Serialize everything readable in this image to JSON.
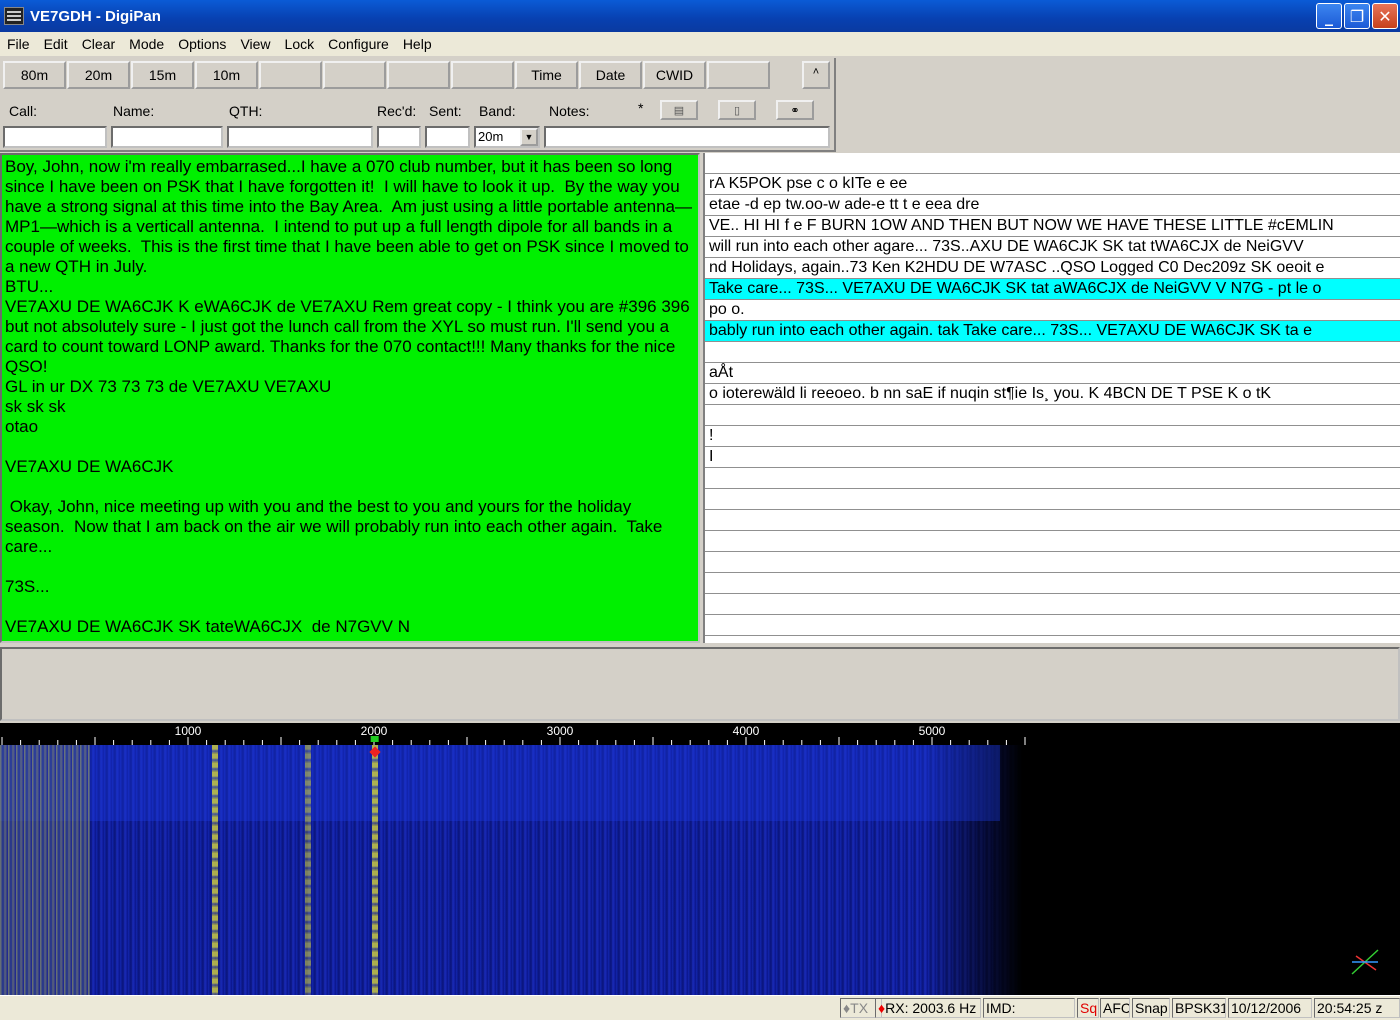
{
  "window": {
    "title": "VE7GDH - DigiPan"
  },
  "menu": [
    "File",
    "Edit",
    "Clear",
    "Mode",
    "Options",
    "View",
    "Lock",
    "Configure",
    "Help"
  ],
  "toolbar": {
    "buttons": [
      "80m",
      "20m",
      "15m",
      "10m",
      "",
      "",
      "",
      "",
      "Time",
      "Date",
      "CWID",
      ""
    ],
    "scroll_up": "˄"
  },
  "log": {
    "call_label": "Call:",
    "name_label": "Name:",
    "qth_label": "QTH:",
    "recd_label": "Rec'd:",
    "sent_label": "Sent:",
    "band_label": "Band:",
    "notes_label": "Notes:",
    "star": "*",
    "call_value": "",
    "name_value": "",
    "qth_value": "",
    "recd_value": "",
    "sent_value": "",
    "band_value": "20m",
    "notes_value": ""
  },
  "rx_text": "Boy, John, now i'm really embarrased...I have a 070 club number, but it has been so long since I have been on PSK that I have forgotten it!  I will have to look it up.  By the way you have a strong signal at this time into the Bay Area.  Am just using a little portable antenna—MP1—which is a verticall antenna.  I intend to put up a full length dipole for all bands in a couple of weeks.  This is the first time that I have been able to get on PSK since I moved to a new QTH in July.\nBTU...\nVE7AXU DE WA6CJK K eWA6CJK de VE7AXU Rem great copy - I think you are #396 396 but not absolutely sure - I just got the lunch call from the XYL so must run. I'll send you a card to count toward LONP award. Thanks for the 070 contact!!! Many thanks for the nice QSO!\nGL in ur DX 73 73 73 de VE7AXU VE7AXU\nsk sk sk\notao\n\nVE7AXU DE WA6CJK\n\n Okay, John, nice meeting up with you and the best to you and yours for the holiday season.  Now that I am back on the air we will probably run into each other again.  Take care...\n\n73S...\n\nVE7AXU DE WA6CJK SK tateWA6CJX  de N7GVV N",
  "channels": [
    {
      "text": "",
      "highlight": false
    },
    {
      "text": "rA K5POK pse c o kITe e ee",
      "highlight": false
    },
    {
      "text": "etae -d ep tw.oo-w ade-e tt t e eea dre",
      "highlight": false
    },
    {
      "text": "VE.. HI HI f e F BURN 1OW AND THEN BUT NOW WE HAVE THESE LITTLE #cEMLIN",
      "highlight": false
    },
    {
      "text": "will run into each other agare... 73S..AXU DE WA6CJK SK tat tWA6CJX de NeiGVV",
      "highlight": false
    },
    {
      "text": "nd Holidays, again..73 Ken K2HDU DE W7ASC ..QSO Logged C0 Dec209z SK oeoit e",
      "highlight": false
    },
    {
      "text": "Take care... 73S... VE7AXU DE WA6CJK SK tat aWA6CJX de NeiGVV V N7G - pt le o",
      "highlight": true
    },
    {
      "text": "po o.",
      "highlight": false
    },
    {
      "text": "bably run into each other again. tak Take care... 73S... VE7AXU DE WA6CJK SK ta e",
      "highlight": true
    },
    {
      "text": "",
      "highlight": false
    },
    {
      "text": "aÅt",
      "highlight": false
    },
    {
      "text": "o ioterewäld li reeoeo. b nn saE if nuqin st¶ie Is¸ you. K 4BCN DE T PSE K o tK",
      "highlight": false
    },
    {
      "text": "",
      "highlight": false
    },
    {
      "text": "!",
      "highlight": false
    },
    {
      "text": "I",
      "highlight": false
    },
    {
      "text": "",
      "highlight": false
    },
    {
      "text": "",
      "highlight": false
    },
    {
      "text": "",
      "highlight": false
    },
    {
      "text": "",
      "highlight": false
    },
    {
      "text": "",
      "highlight": false
    },
    {
      "text": "",
      "highlight": false
    },
    {
      "text": "",
      "highlight": false
    },
    {
      "text": "",
      "highlight": false
    }
  ],
  "waterfall": {
    "scale_labels": [
      "1000",
      "2000",
      "3000",
      "4000",
      "5000"
    ],
    "cursor_hz": 2003.6
  },
  "status": {
    "tx": "TX",
    "rx": "RX: 2003.6 Hz",
    "imd": "IMD:",
    "sq": "Sq",
    "afc": "AFC",
    "snap": "Snap",
    "mode": "BPSK31",
    "date": "10/12/2006",
    "time": "20:54:25 z"
  },
  "colors": {
    "rx_background": "#00f000",
    "channel_highlight": "#00ffff",
    "title_bar": "#0a5bd6"
  }
}
